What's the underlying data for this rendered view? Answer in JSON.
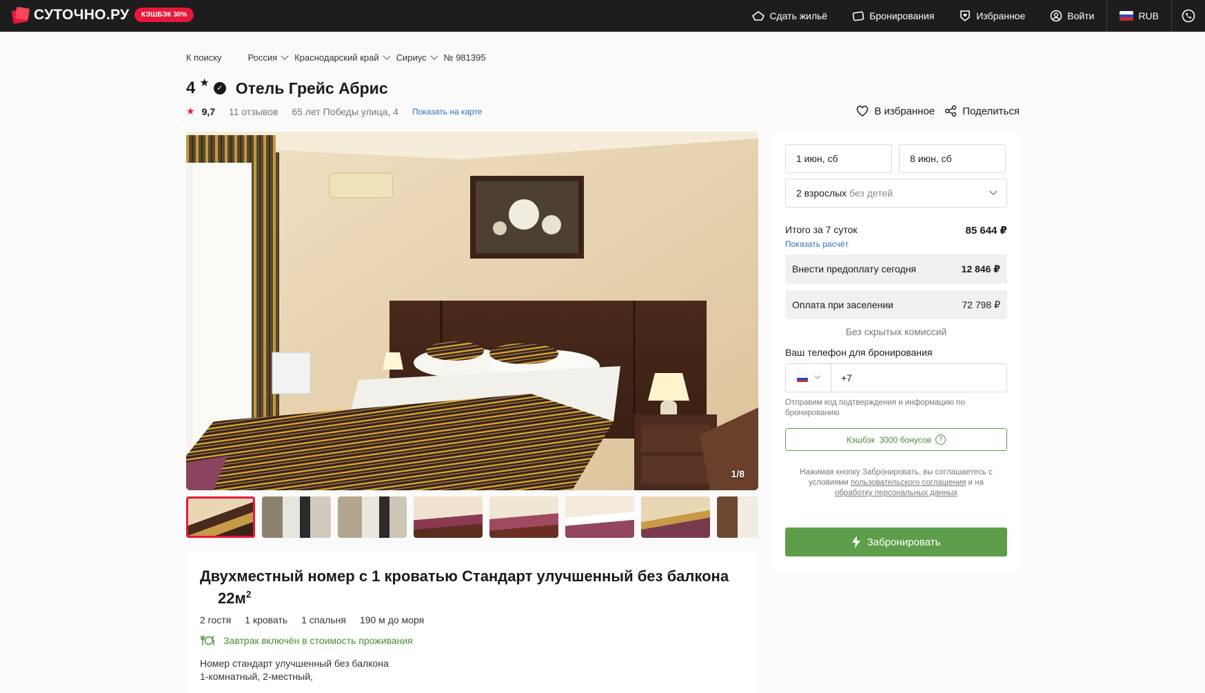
{
  "header": {
    "logo_text": "СУТОЧНО.РУ",
    "cashback_badge": "КЭШБЭК 30%",
    "nav": {
      "rent_out": "Сдать жильё",
      "bookings": "Бронирования",
      "favorites": "Избранное",
      "login": "Войти",
      "currency": "RUB"
    }
  },
  "breadcrumb": {
    "back": "К поиску",
    "country": "Россия",
    "region": "Краснодарский край",
    "city": "Сириус",
    "listing_number": "№ 981395"
  },
  "hotel": {
    "stars": "4",
    "star_glyph": "★",
    "verified_glyph": "✓",
    "name": "Отель Грейс Абрис",
    "rating": "9,7",
    "reviews": "11 отзывов",
    "address": "65 лет Победы улица, 4",
    "map_link": "Показать на карте",
    "add_favorite": "В избранное",
    "share": "Поделиться"
  },
  "gallery": {
    "counter": "1/8",
    "thumb_count": 8,
    "active_index": 0
  },
  "room": {
    "title": "Двухместный номер с 1 кроватью Стандарт улучшенный без балкона",
    "area": "22м",
    "area_sup": "2",
    "features": [
      "2 гостя",
      "1 кровать",
      "1 спальня",
      "190 м до моря"
    ],
    "breakfast": "Завтрак включён в стоимость проживания",
    "description_line1": "Номер стандарт улучшенный без балкона",
    "description_line2": "1-комнатный, 2-местный,"
  },
  "booking": {
    "check_in": "1 июн, сб",
    "check_out": "8 июн, сб",
    "guests_main": "2 взрослых",
    "guests_sub": "без детей",
    "total_label": "Итого за 7 суток",
    "total_price": "85 644 ₽",
    "show_calc": "Показать расчёт",
    "prepay_label": "Внести предоплату сегодня",
    "prepay_value": "12 846 ₽",
    "checkin_pay_label": "Оплата при заселении",
    "checkin_pay_value": "72 798 ₽",
    "no_fees": "Без скрытых комиссий",
    "phone_label": "Ваш телефон для бронирования",
    "phone_value": "+7",
    "phone_hint": "Отправим код подтверждения и информацию по бронированию",
    "cashback": "Кэшбэк  3000 бонусов",
    "agree_text_1": "Нажимая кнопку Забронировать, вы соглашаетесь с условиями",
    "agree_link_1": "пользовательского соглашения",
    "agree_text_2": "и на",
    "agree_link_2": "обработку персональных данных",
    "book_button": "Забронировать"
  },
  "colors": {
    "accent_red": "#e8173a",
    "accent_green": "#5e9e4a",
    "link_blue": "#2f6fb6",
    "header_bg": "#1d1d1d"
  },
  "icons": [
    "house-icon",
    "bookings-icon",
    "heart-shield-icon",
    "user-circle-icon",
    "ru-flag-icon",
    "phone-chat-icon",
    "chevron-down-icon",
    "verified-icon",
    "star-icon",
    "heart-icon",
    "share-icon",
    "breakfast-icon",
    "question-icon",
    "lightning-icon"
  ]
}
